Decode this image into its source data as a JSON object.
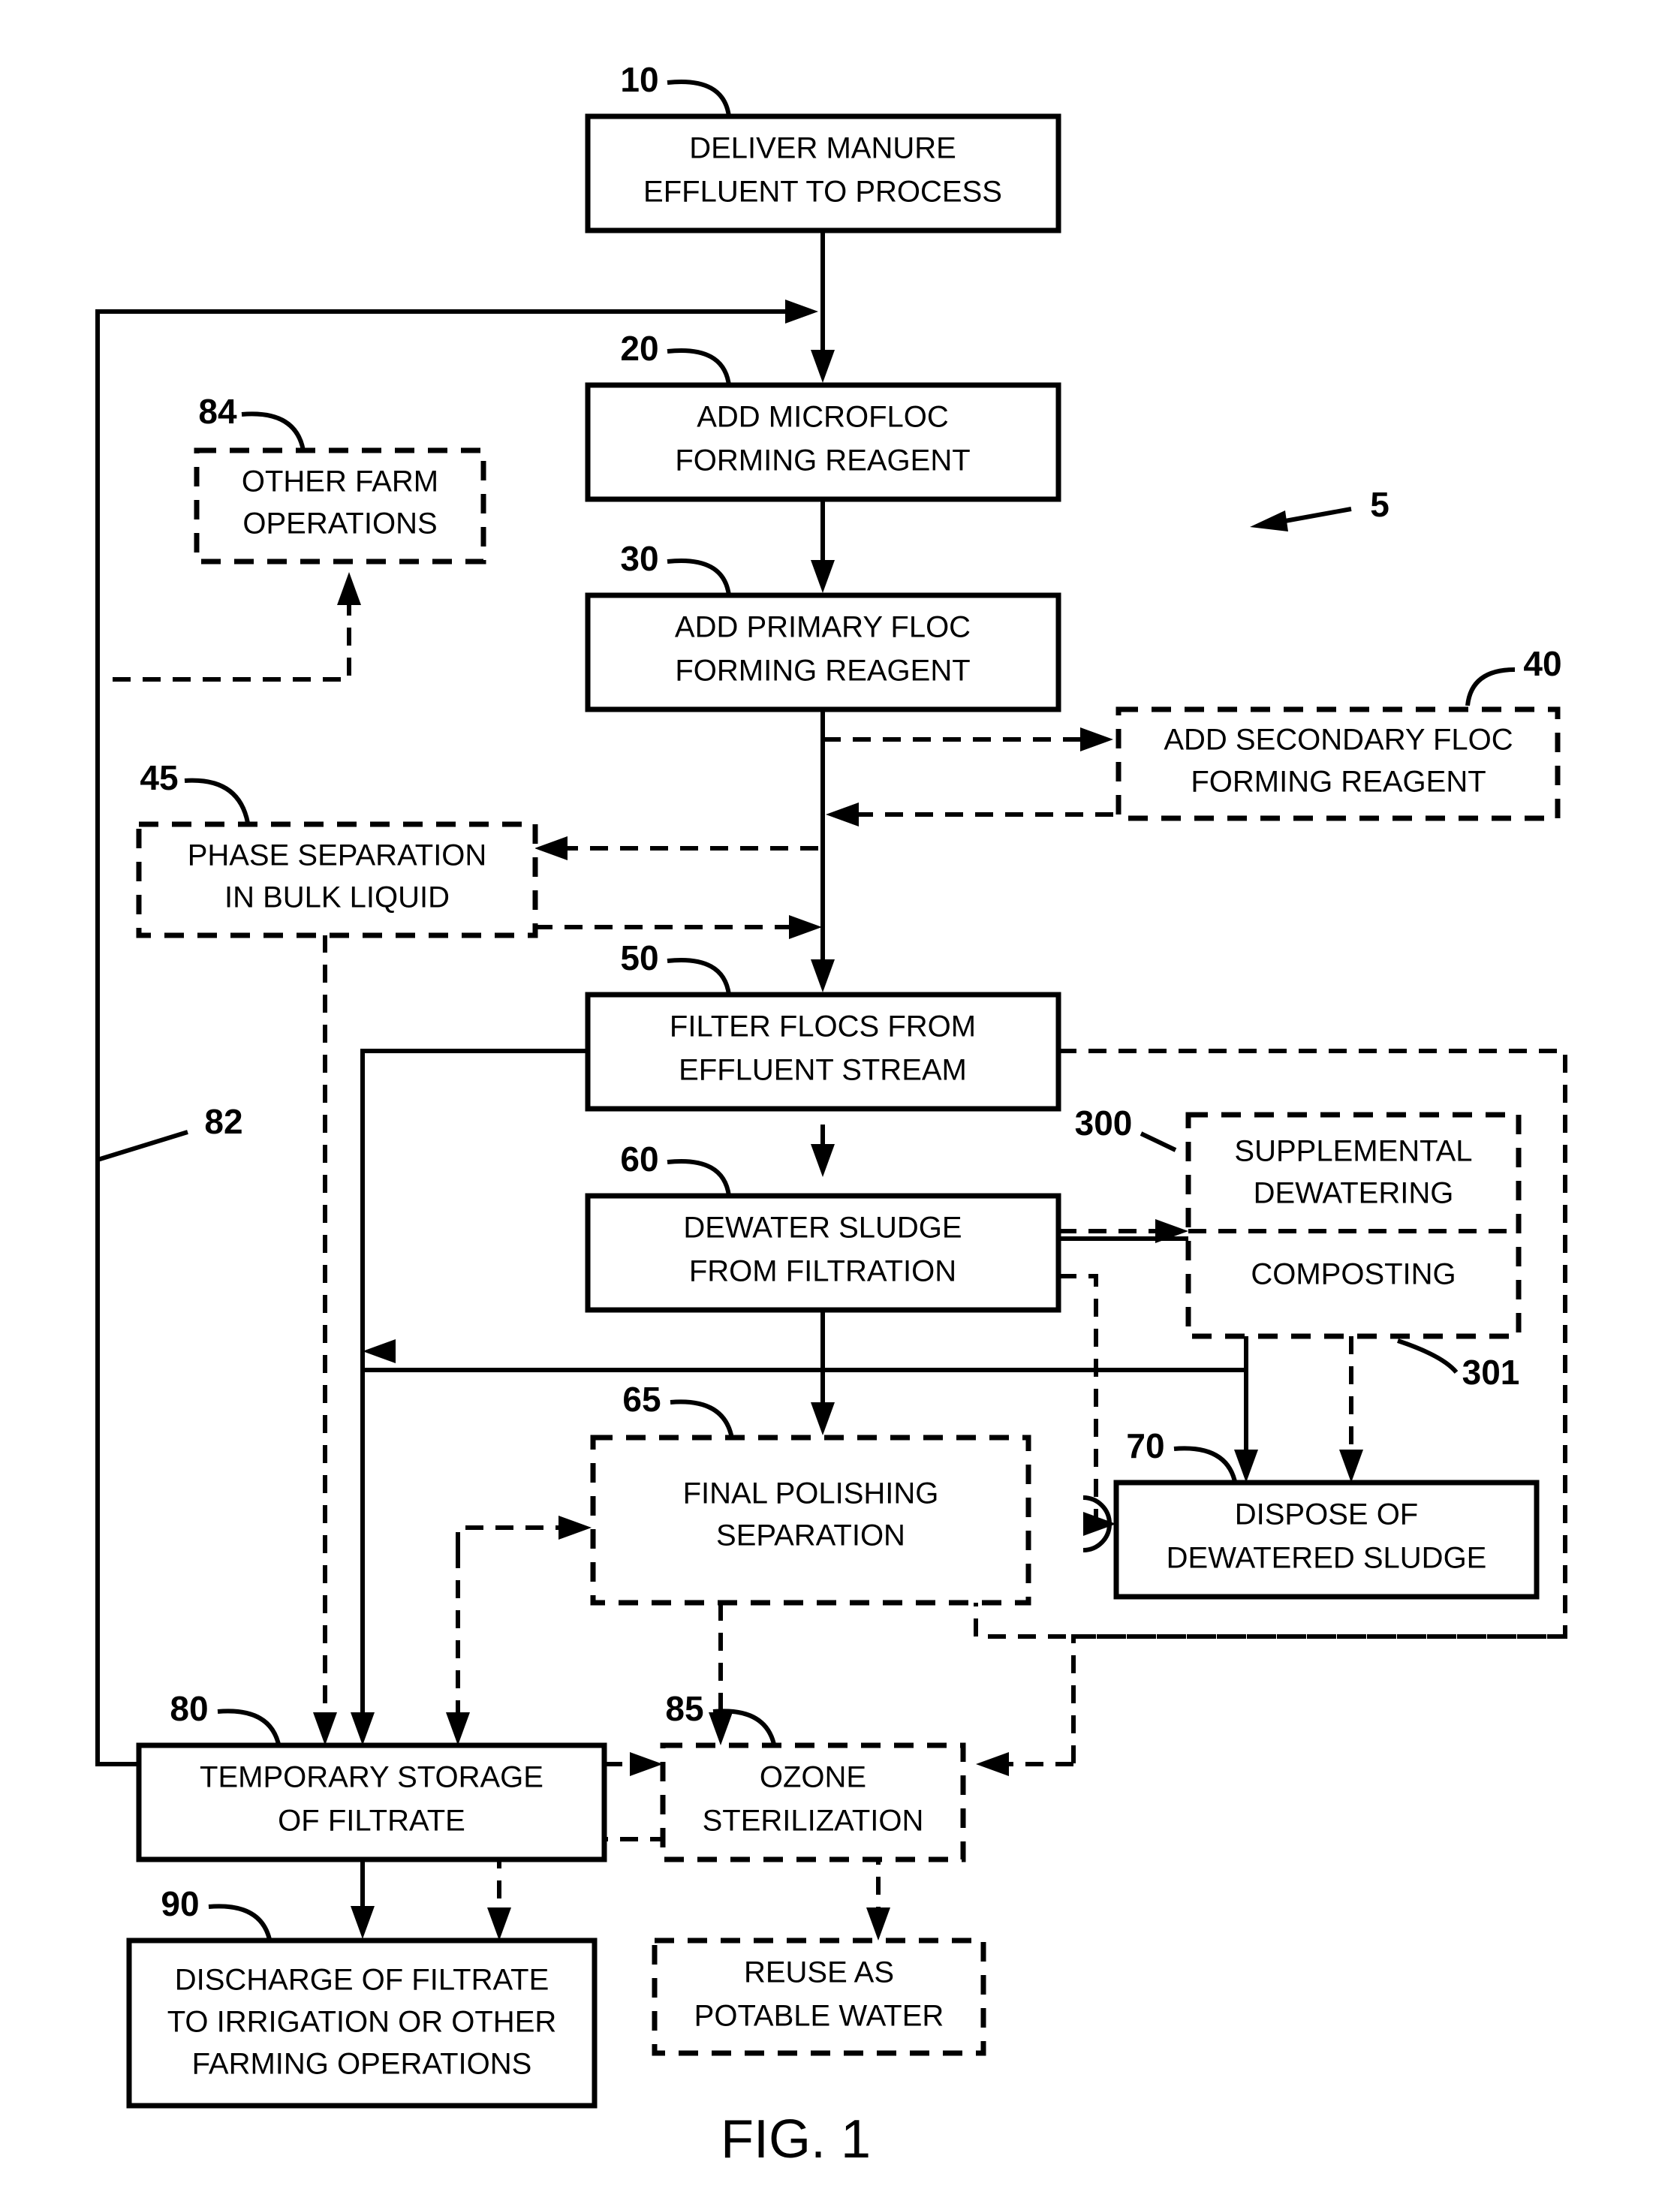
{
  "figure": {
    "caption": "FIG. 1",
    "system_ref": "5"
  },
  "nodes": [
    {
      "id": "n10",
      "ref": "10",
      "style": "solid",
      "lines": [
        "DELIVER MANURE",
        "EFFLUENT TO PROCESS"
      ]
    },
    {
      "id": "n20",
      "ref": "20",
      "style": "solid",
      "lines": [
        "ADD MICROFLOC",
        "FORMING REAGENT"
      ]
    },
    {
      "id": "n30",
      "ref": "30",
      "style": "solid",
      "lines": [
        "ADD PRIMARY FLOC",
        "FORMING REAGENT"
      ]
    },
    {
      "id": "n40",
      "ref": "40",
      "style": "dashed",
      "lines": [
        "ADD SECONDARY FLOC",
        "FORMING REAGENT"
      ]
    },
    {
      "id": "n45",
      "ref": "45",
      "style": "dashed",
      "lines": [
        "PHASE SEPARATION",
        "IN BULK LIQUID"
      ]
    },
    {
      "id": "n50",
      "ref": "50",
      "style": "solid",
      "lines": [
        "FILTER FLOCS FROM",
        "EFFLUENT STREAM"
      ]
    },
    {
      "id": "n60",
      "ref": "60",
      "style": "solid",
      "lines": [
        "DEWATER SLUDGE",
        "FROM FILTRATION"
      ]
    },
    {
      "id": "n65",
      "ref": "65",
      "style": "dashed",
      "lines": [
        "FINAL POLISHING",
        "SEPARATION"
      ]
    },
    {
      "id": "n70",
      "ref": "70",
      "style": "solid",
      "lines": [
        "DISPOSE OF",
        "DEWATERED SLUDGE"
      ]
    },
    {
      "id": "n80",
      "ref": "80",
      "style": "solid",
      "lines": [
        "TEMPORARY STORAGE",
        "OF FILTRATE"
      ]
    },
    {
      "id": "n84",
      "ref": "84",
      "style": "dashed",
      "lines": [
        "OTHER FARM",
        "OPERATIONS"
      ]
    },
    {
      "id": "n85",
      "ref": "85",
      "style": "dashed",
      "lines": [
        "OZONE",
        "STERILIZATION"
      ]
    },
    {
      "id": "n90",
      "ref": "90",
      "style": "solid",
      "lines": [
        "DISCHARGE OF FILTRATE",
        "TO IRRIGATION OR OTHER",
        "FARMING OPERATIONS"
      ]
    },
    {
      "id": "n300",
      "ref": "300",
      "style": "dashed",
      "lines": [
        "SUPPLEMENTAL",
        "DEWATERING"
      ]
    },
    {
      "id": "n301",
      "ref": "301",
      "style": "dashed",
      "lines": [
        "COMPOSTING"
      ]
    },
    {
      "id": "npot",
      "ref": "",
      "style": "dashed",
      "lines": [
        "REUSE AS",
        "POTABLE WATER"
      ]
    }
  ],
  "line_refs": [
    {
      "id": "r82",
      "ref": "82",
      "describes": "filtrate-recycle-line"
    }
  ],
  "colors": {
    "stroke": "#000000",
    "background": "#ffffff"
  }
}
